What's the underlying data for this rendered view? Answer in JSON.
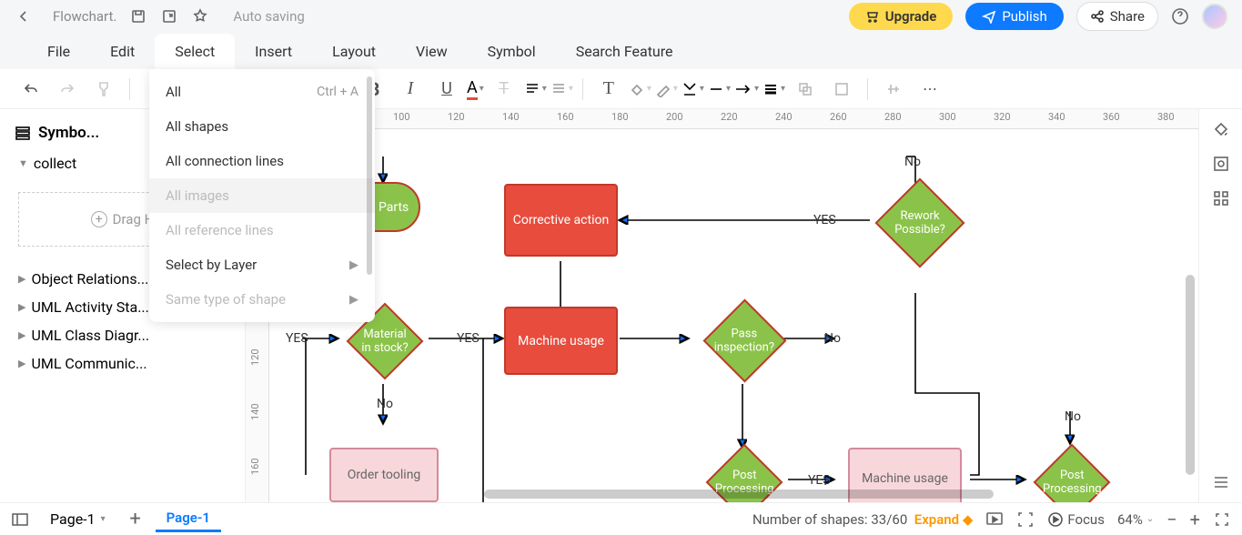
{
  "top": {
    "filename": "Flowchart.",
    "autosave": "Auto saving",
    "upgrade": "Upgrade",
    "publish": "Publish",
    "share": "Share"
  },
  "menu": {
    "items": [
      "File",
      "Edit",
      "Select",
      "Insert",
      "Layout",
      "View",
      "Symbol",
      "Search Feature"
    ],
    "active_index": 2
  },
  "dropdown": {
    "items": [
      {
        "label": "All",
        "shortcut": "Ctrl + A",
        "enabled": true
      },
      {
        "label": "All shapes",
        "enabled": true
      },
      {
        "label": "All connection lines",
        "enabled": true
      },
      {
        "label": "All images",
        "enabled": false,
        "hovered": true
      },
      {
        "label": "All reference lines",
        "enabled": false
      },
      {
        "label": "Select by Layer",
        "enabled": true,
        "submenu": true
      },
      {
        "label": "Same type of shape",
        "enabled": false,
        "submenu": true
      }
    ]
  },
  "sidebar": {
    "title": "Symbo...",
    "group_open": "collect",
    "drag_hint": "Drag H",
    "groups": [
      "Object Relations...",
      "UML Activity Sta...",
      "UML Class Diagr...",
      "UML Communic..."
    ]
  },
  "ruler_h": [
    "100",
    "120",
    "140",
    "160",
    "180",
    "200",
    "220",
    "240",
    "260",
    "280",
    "300",
    "320",
    "340",
    "360",
    "380"
  ],
  "ruler_v": [
    "120",
    "140",
    "160"
  ],
  "shapes": {
    "p_parts": "p Parts",
    "corrective": "Corrective action",
    "rework": "Rework Possible?",
    "material": "Material in stock?",
    "machine1": "Machine usage",
    "pass": "Pass inspection?",
    "order": "Order tooling",
    "post1": "Post Processing",
    "machine2": "Machine usage",
    "post2": "Post Processing"
  },
  "labels": {
    "yes1": "YES",
    "yes2": "YES",
    "yes3": "YES",
    "no1": "No",
    "no2": "No",
    "no3": "No",
    "no4": "No"
  },
  "footer": {
    "page_dropdown": "Page-1",
    "page_active": "Page-1",
    "shapes_count": "Number of shapes: 33/60",
    "expand": "Expand",
    "focus": "Focus",
    "zoom": "64%"
  }
}
